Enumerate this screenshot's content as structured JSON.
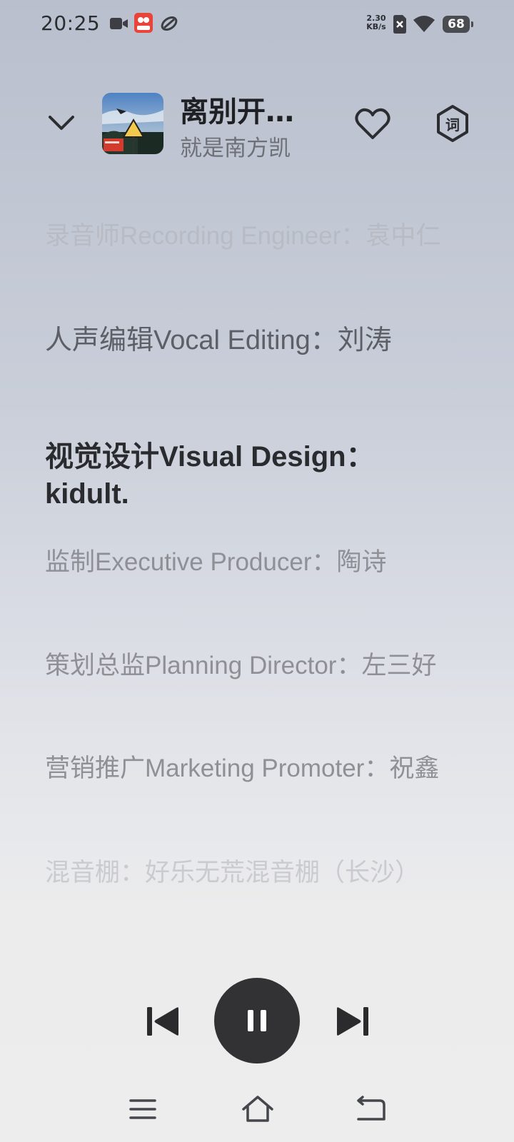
{
  "status_bar": {
    "time": "20:25",
    "net_speed_value": "2.30",
    "net_speed_unit": "KB/s",
    "battery": "68",
    "icons": [
      "video-camera-icon",
      "app-notification-icon",
      "sync-icon",
      "no-sim-icon",
      "wifi-icon",
      "battery-icon"
    ]
  },
  "player": {
    "song_title": "离别开…",
    "artist": "就是南方凯",
    "favorite_icon": "heart-outline-icon",
    "lyrics_icon_char": "词",
    "collapse_icon": "chevron-down-icon"
  },
  "lyrics": [
    {
      "text": "录音师Recording Engineer：袁中仁",
      "style": "fade"
    },
    {
      "text": "人声编辑Vocal Editing：刘涛",
      "style": "mid"
    },
    {
      "text": "视觉设计Visual Design：kidult.",
      "style": "current"
    },
    {
      "text": "监制Executive Producer：陶诗",
      "style": "normal"
    },
    {
      "text": "策划总监Planning Director：左三好",
      "style": "normal"
    },
    {
      "text": "营销推广Marketing Promoter：祝鑫",
      "style": "normal"
    },
    {
      "text": "混音棚：好乐无荒混音棚（长沙）",
      "style": "fade"
    }
  ],
  "controls": {
    "previous_icon": "skip-previous-icon",
    "play_pause_icon": "pause-icon",
    "next_icon": "skip-next-icon"
  },
  "nav_bar": {
    "menu_icon": "menu-icon",
    "home_icon": "home-icon",
    "back_icon": "back-icon"
  }
}
